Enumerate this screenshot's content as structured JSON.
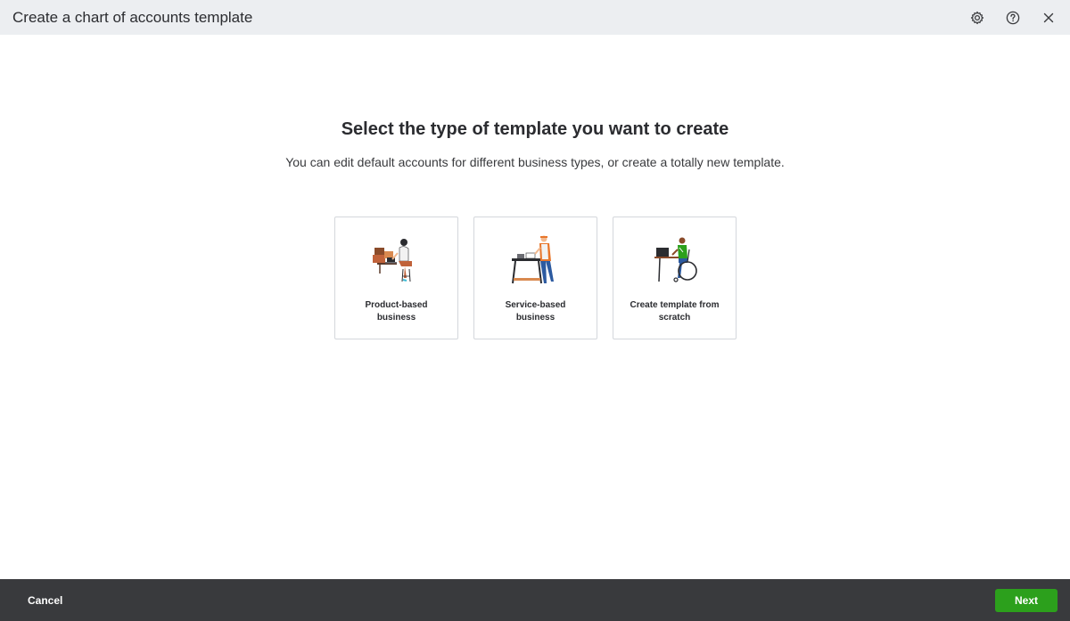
{
  "window": {
    "title": "Create a chart of accounts template",
    "icons": [
      "gear-icon",
      "help-icon",
      "close-icon"
    ]
  },
  "main": {
    "heading": "Select the type of template you want to create",
    "subheading": "You can edit default accounts for different business types, or create a totally new template.",
    "cards": [
      {
        "label": "Product-based business",
        "icon": "product-business-illustration"
      },
      {
        "label": "Service-based business",
        "icon": "service-business-illustration"
      },
      {
        "label": "Create template from scratch",
        "icon": "scratch-template-illustration"
      }
    ]
  },
  "footer": {
    "cancel_label": "Cancel",
    "next_label": "Next"
  },
  "colors": {
    "header_bg": "#eceef1",
    "footer_bg": "#393a3d",
    "next_button": "#2ca01c",
    "card_border": "#d4d7dc"
  }
}
